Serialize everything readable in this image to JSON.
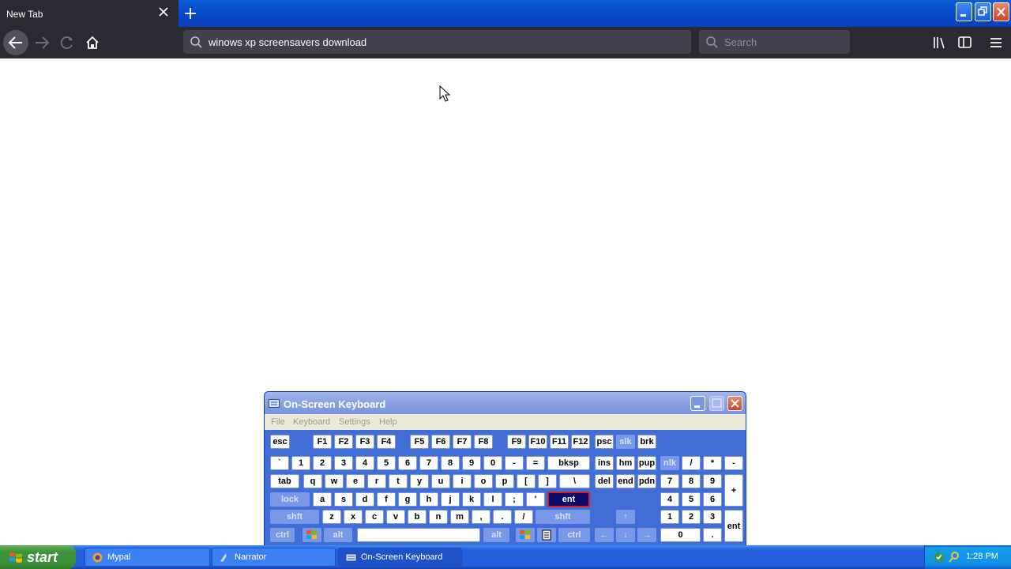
{
  "browser": {
    "tab_title": "New Tab",
    "url_text": "winows xp screensavers download",
    "search_placeholder": "Search"
  },
  "osk": {
    "title": "On-Screen Keyboard",
    "menu": [
      "File",
      "Keyboard",
      "Settings",
      "Help"
    ],
    "rows": {
      "fn": [
        "esc",
        "F1",
        "F2",
        "F3",
        "F4",
        "F5",
        "F6",
        "F7",
        "F8",
        "F9",
        "F10",
        "F11",
        "F12",
        "psc",
        "slk",
        "brk"
      ],
      "num": [
        "`",
        "1",
        "2",
        "3",
        "4",
        "5",
        "6",
        "7",
        "8",
        "9",
        "0",
        "-",
        "=",
        "bksp",
        "ins",
        "hm",
        "pup",
        "nlk",
        "/",
        "*",
        "-"
      ],
      "top": [
        "tab",
        "q",
        "w",
        "e",
        "r",
        "t",
        "y",
        "u",
        "i",
        "o",
        "p",
        "[",
        "]",
        "\\",
        "del",
        "end",
        "pdn",
        "7",
        "8",
        "9",
        "+"
      ],
      "home": [
        "lock",
        "a",
        "s",
        "d",
        "f",
        "g",
        "h",
        "j",
        "k",
        "l",
        ";",
        "'",
        "ent",
        "4",
        "5",
        "6"
      ],
      "shift": [
        "shft",
        "z",
        "x",
        "c",
        "v",
        "b",
        "n",
        "m",
        ",",
        ".",
        "/",
        "shft",
        "1",
        "2",
        "3",
        "ent"
      ],
      "bottom": [
        "ctrl",
        "alt",
        "alt",
        "ctrl",
        "0",
        "."
      ]
    }
  },
  "taskbar": {
    "start_label": "start",
    "items": [
      "Mypal",
      "Narrator",
      "On-Screen Keyboard"
    ],
    "clock": "1:28 PM"
  },
  "icons": {
    "arrow_up": "↑",
    "arrow_left": "←",
    "arrow_down": "↓",
    "arrow_right": "→"
  }
}
